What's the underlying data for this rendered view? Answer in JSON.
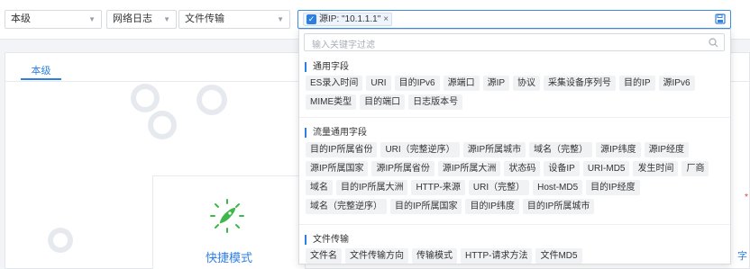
{
  "filters": {
    "scope": "本级",
    "log_type": "网络日志",
    "sub_type": "文件传输"
  },
  "query": {
    "tag": "源IP: \"10.1.1.1\"",
    "close": "×"
  },
  "panel": {
    "tab": "本级",
    "card_title": "快捷模式",
    "edge_text": "字"
  },
  "dropdown": {
    "search_placeholder": "输入关键字过滤",
    "groups": [
      {
        "title": "通用字段",
        "fields": [
          "ES录入时间",
          "URI",
          "目的IPv6",
          "源端口",
          "源IP",
          "协议",
          "采集设备序列号",
          "目的IP",
          "源IPv6",
          "MIME类型",
          "目的端口",
          "日志版本号"
        ]
      },
      {
        "title": "流量通用字段",
        "fields": [
          "目的IP所属省份",
          "URI（完整逆序）",
          "源IP所属城市",
          "域名（完整）",
          "源IP纬度",
          "源IP经度",
          "源IP所属国家",
          "源IP所属省份",
          "源IP所属大洲",
          "状态码",
          "设备IP",
          "URI-MD5",
          "发生时间",
          "厂商",
          "域名",
          "目的IP所属大洲",
          "HTTP-来源",
          "URI（完整）",
          "Host-MD5",
          "目的IP经度",
          "域名（完整逆序）",
          "目的IP所属国家",
          "目的IP纬度",
          "目的IP所属城市"
        ]
      },
      {
        "title": "文件传输",
        "fields": [
          "文件名",
          "文件传输方向",
          "传输模式",
          "HTTP-请求方法",
          "文件MD5"
        ]
      }
    ]
  }
}
